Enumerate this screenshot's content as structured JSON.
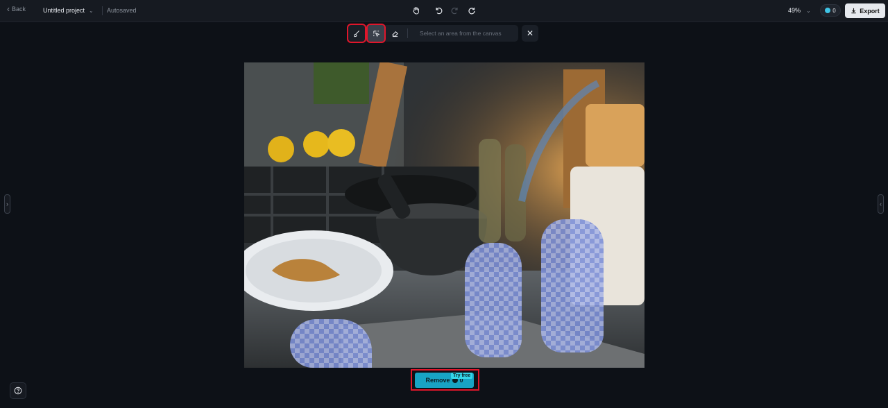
{
  "header": {
    "back_label": "Back",
    "project_title": "Untitled project",
    "save_status": "Autosaved",
    "zoom": "49%",
    "credits": "0",
    "export_label": "Export"
  },
  "selection_toolbar": {
    "hint": "Select an area from the canvas"
  },
  "actions": {
    "remove_label": "Remove",
    "remove_cost": "0",
    "try_free_badge": "Try free"
  },
  "colors": {
    "accent": "#18a3c4",
    "highlight": "#e0162b",
    "background": "#0d1117",
    "mask": "#7c8fd8"
  }
}
